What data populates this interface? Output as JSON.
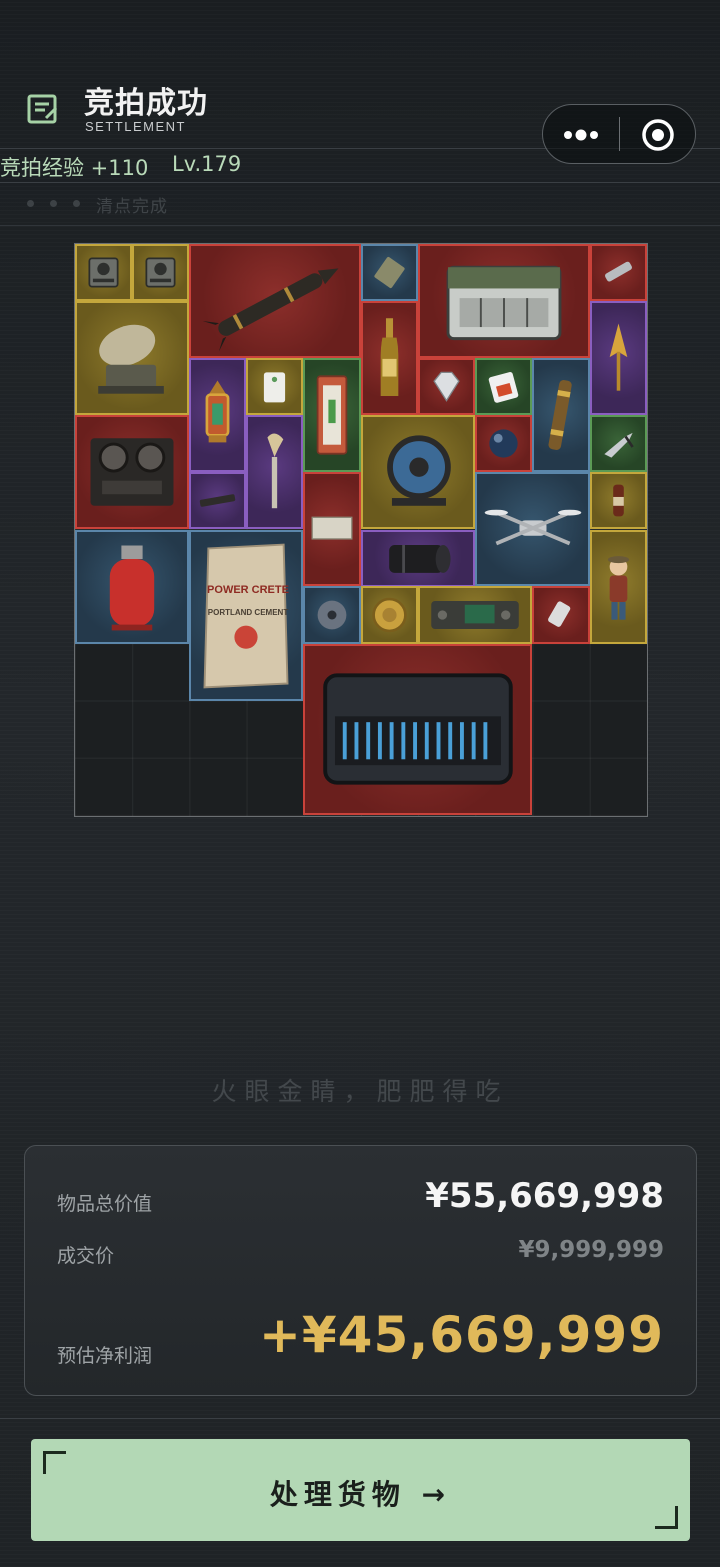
{
  "header": {
    "title": "竞拍成功",
    "subtitle": "SETTLEMENT",
    "icon": "receipt-icon",
    "capsule": {
      "more_icon": "more-icon",
      "close_icon": "target-icon"
    }
  },
  "experience": {
    "label": "竞拍经验 +110",
    "level": "Lv.179"
  },
  "status": {
    "text": "清点完成"
  },
  "inventory": {
    "grid": "10 x 10",
    "items": [
      {
        "name": "radio-receiver-icon",
        "rarity": "gold"
      },
      {
        "name": "radio-receiver-icon",
        "rarity": "gold"
      },
      {
        "name": "missile-icon",
        "rarity": "red"
      },
      {
        "name": "ration-pack-icon",
        "rarity": "blue"
      },
      {
        "name": "military-case-icon",
        "rarity": "red"
      },
      {
        "name": "flashlight-icon",
        "rarity": "red"
      },
      {
        "name": "radar-dish-icon",
        "rarity": "gold"
      },
      {
        "name": "champagne-bottle-icon",
        "rarity": "red"
      },
      {
        "name": "arrowhead-icon",
        "rarity": "purple"
      },
      {
        "name": "lantern-icon",
        "rarity": "purple"
      },
      {
        "name": "tag-icon",
        "rarity": "gold"
      },
      {
        "name": "fire-extinguisher-box-icon",
        "rarity": "green"
      },
      {
        "name": "diamond-icon",
        "rarity": "red"
      },
      {
        "name": "battery-icon",
        "rarity": "green"
      },
      {
        "name": "telescope-icon",
        "rarity": "blue"
      },
      {
        "name": "tape-recorder-icon",
        "rarity": "red"
      },
      {
        "name": "torch-icon",
        "rarity": "purple"
      },
      {
        "name": "cable-reel-icon",
        "rarity": "gold"
      },
      {
        "name": "glass-orb-icon",
        "rarity": "red"
      },
      {
        "name": "pliers-icon",
        "rarity": "green"
      },
      {
        "name": "knife-icon",
        "rarity": "purple"
      },
      {
        "name": "drone-icon",
        "rarity": "blue"
      },
      {
        "name": "small-bottle-icon",
        "rarity": "gold"
      },
      {
        "name": "banknote-icon",
        "rarity": "red"
      },
      {
        "name": "figurine-icon",
        "rarity": "gold"
      },
      {
        "name": "gas-cylinder-icon",
        "rarity": "blue"
      },
      {
        "name": "cement-bag-icon",
        "rarity": "blue"
      },
      {
        "name": "camera-lens-icon",
        "rarity": "purple"
      },
      {
        "name": "hard-drive-icon",
        "rarity": "blue"
      },
      {
        "name": "gold-medal-icon",
        "rarity": "gold"
      },
      {
        "name": "control-panel-icon",
        "rarity": "gold"
      },
      {
        "name": "usb-drive-icon",
        "rarity": "red"
      },
      {
        "name": "server-rack-icon",
        "rarity": "red"
      }
    ],
    "cement_bag_text": [
      "POWER CRETE",
      "PORTLAND CEMENT"
    ]
  },
  "slogan": "火眼金睛，肥肥得吃",
  "summary": {
    "total_label": "物品总价值",
    "total_value": "¥55,669,998",
    "deal_label": "成交价",
    "deal_value": "¥9,999,999",
    "profit_label": "预估净利润",
    "profit_value": "+¥45,669,999"
  },
  "action": {
    "label": "处理货物 →"
  },
  "colors": {
    "accent_green": "#b3d8b5",
    "profit_gold": "#e0b95a",
    "rarity_gold": "#c4a73c",
    "rarity_red": "#c9423a",
    "rarity_blue": "#5b86aa",
    "rarity_purple": "#8a5ec0",
    "rarity_green": "#5b9a55"
  }
}
